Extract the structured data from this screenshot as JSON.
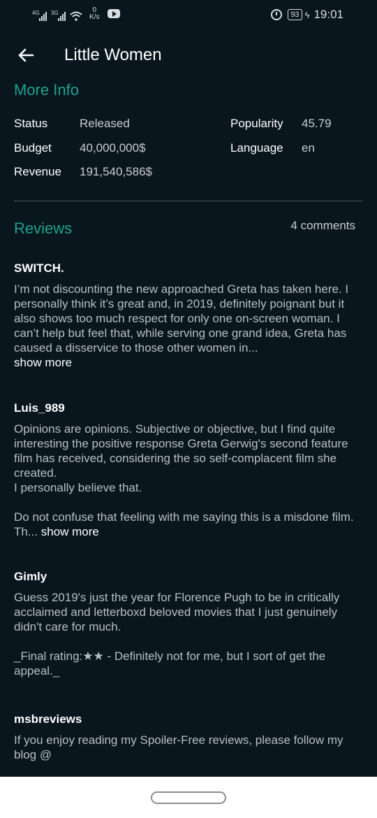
{
  "status_bar": {
    "net1": "4G",
    "net2": "3G",
    "speed_value": "0",
    "speed_unit": "K/s",
    "battery": "93",
    "time": "19:01"
  },
  "header": {
    "title": "Little Women"
  },
  "more_info": {
    "heading": "More Info",
    "status_label": "Status",
    "status_value": "Released",
    "budget_label": "Budget",
    "budget_value": "40,000,000$",
    "revenue_label": "Revenue",
    "revenue_value": "191,540,586$",
    "popularity_label": "Popularity",
    "popularity_value": "45.79",
    "language_label": "Language",
    "language_value": "en"
  },
  "reviews": {
    "heading": "Reviews",
    "count": "4 comments",
    "items": [
      {
        "author": "SWITCH.",
        "body": "I’m not discounting the new approached Greta has taken here. I personally think it’s great and, in 2019, definitely poignant but it also shows too much respect for only one on-screen woman. I can’t help but feel that, while serving one grand idea, Greta has caused a disservice to those other women in...",
        "more": "show more"
      },
      {
        "author": "Luis_989",
        "body": "Opinions are opinions. Subjective or objective, but I find quite interesting the positive response Greta Gerwig's second feature film has received, considering the so self-complacent film she created.\nI personally believe that.\n\nDo not confuse that feeling with me saying this is a misdone film. Th... ",
        "more": "show more"
      },
      {
        "author": "Gimly",
        "body": "Guess 2019's just the year for Florence Pugh to be in critically acclaimed and letterboxd beloved movies that I just genuinely didn't care for much.\n\n_Final rating:★★ - Definitely not for me, but I sort of get the appeal._"
      },
      {
        "author": "msbreviews",
        "body": "If you enjoy reading my Spoiler-Free reviews, please follow my blog @"
      }
    ]
  },
  "colors": {
    "background": "#09161e",
    "accent": "#1fa38d"
  }
}
